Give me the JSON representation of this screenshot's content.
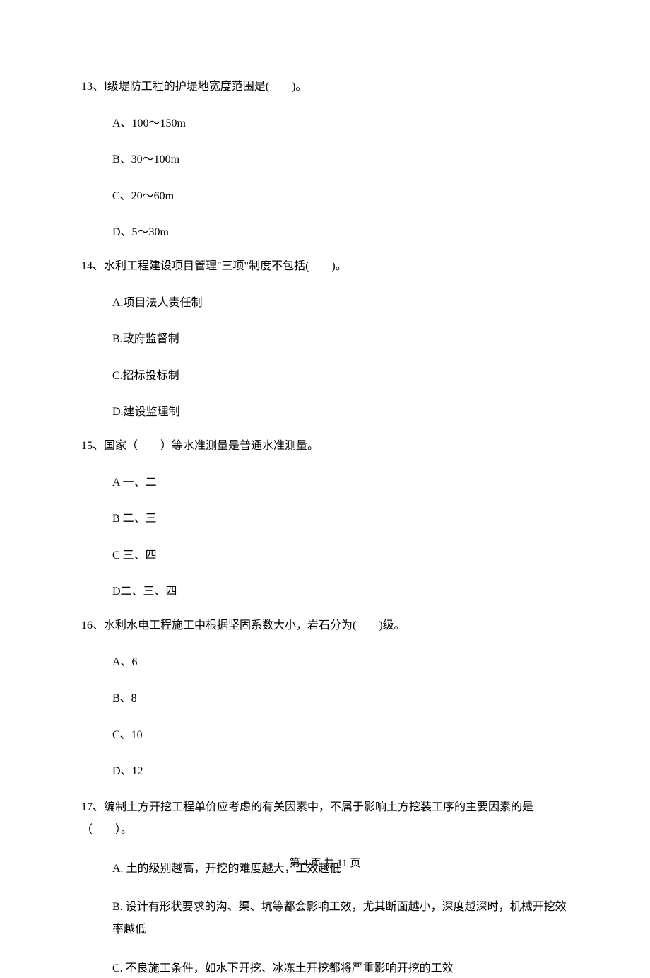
{
  "questions": [
    {
      "number": "13、",
      "text": "Ⅰ级堤防工程的护堤地宽度范围是(　　)。",
      "options": [
        "A、100～150m",
        "B、30～100m",
        "C、20～60m",
        "D、5～30m"
      ]
    },
    {
      "number": "14、",
      "text": "水利工程建设项目管理\"三项\"制度不包括(　　)。",
      "options": [
        "A.项目法人责任制",
        "B.政府监督制",
        "C.招标投标制",
        "D.建设监理制"
      ]
    },
    {
      "number": "15、",
      "text": "国家（　　）等水准测量是普通水准测量。",
      "options": [
        "A 一、二",
        "B 二、三",
        "C  三、四",
        "D二、三、四"
      ]
    },
    {
      "number": "16、",
      "text": "水利水电工程施工中根据坚固系数大小，岩石分为(　　)级。",
      "options": [
        "A、6",
        "B、8",
        "C、10",
        "D、12"
      ]
    },
    {
      "number": "17、",
      "text": "编制土方开挖工程单价应考虑的有关因素中，不属于影响土方挖装工序的主要因素的是（　　）。",
      "options": [
        "A. 土的级别越高，开挖的难度越大，工效越低",
        "B. 设计有形状要求的沟、渠、坑等都会影响工效，尤其断面越小，深度越深时，机械开挖效率越低",
        "C. 不良施工条件，如水下开挖、冰冻土开挖都将严重影响开挖的工效"
      ]
    }
  ],
  "footer": "第 4 页 共 11 页"
}
